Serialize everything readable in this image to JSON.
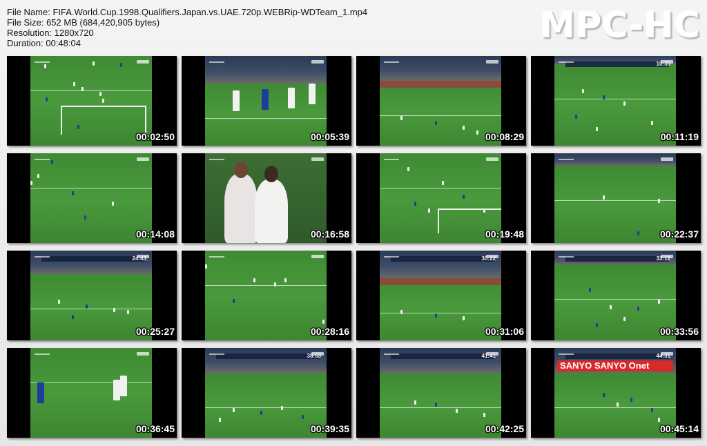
{
  "header": {
    "file_name_label": "File Name: FIFA.World.Cup.1998.Qualifiers.Japan.vs.UAE.720p.WEBRip-WDTeam_1.mp4",
    "file_size_label": "File Size: 652 MB (684,420,905 bytes)",
    "resolution_label": "Resolution: 1280x720",
    "duration_label": "Duration: 00:48:04"
  },
  "brand": "MPC-HC",
  "thumbnails": [
    {
      "time": "00:02:50",
      "clock": ""
    },
    {
      "time": "00:05:39",
      "clock": ""
    },
    {
      "time": "00:08:29",
      "clock": ""
    },
    {
      "time": "00:11:19",
      "clock": "10:35"
    },
    {
      "time": "00:14:08",
      "clock": ""
    },
    {
      "time": "00:16:58",
      "clock": ""
    },
    {
      "time": "00:19:48",
      "clock": ""
    },
    {
      "time": "00:22:37",
      "clock": ""
    },
    {
      "time": "00:25:27",
      "clock": "24:43"
    },
    {
      "time": "00:28:16",
      "clock": ""
    },
    {
      "time": "00:31:06",
      "clock": "30:22"
    },
    {
      "time": "00:33:56",
      "clock": "33:12"
    },
    {
      "time": "00:36:45",
      "clock": ""
    },
    {
      "time": "00:39:35",
      "clock": "38:53"
    },
    {
      "time": "00:42:25",
      "clock": "41:41"
    },
    {
      "time": "00:45:14",
      "clock": "44:31"
    }
  ],
  "last_banner": "SANYO SANYO  Onet"
}
